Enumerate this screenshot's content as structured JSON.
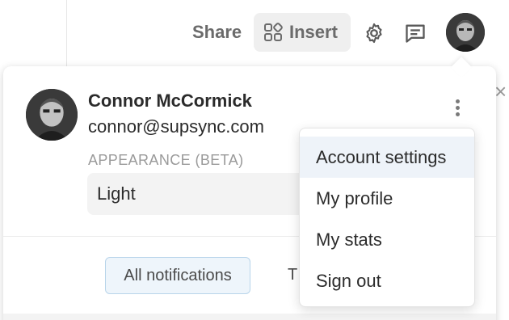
{
  "header": {
    "share_label": "Share",
    "insert_label": "Insert",
    "icons": [
      "apps-grid-icon",
      "gear-icon",
      "chat-icon"
    ]
  },
  "profile": {
    "name": "Connor McCormick",
    "email": "connor@supsync.com"
  },
  "appearance": {
    "label": "APPEARANCE (BETA)",
    "selected": "Light"
  },
  "notifications": {
    "tabs": [
      {
        "label": "All notifications",
        "active": true
      },
      {
        "label": "T",
        "active": false
      }
    ]
  },
  "menu": {
    "items": [
      {
        "label": "Account settings",
        "highlighted": true
      },
      {
        "label": "My profile",
        "highlighted": false
      },
      {
        "label": "My stats",
        "highlighted": false
      },
      {
        "label": "Sign out",
        "highlighted": false
      }
    ]
  },
  "colors": {
    "menu_highlight": "#eef3f9",
    "active_tab_bg": "#eef5fb",
    "active_tab_border": "#b8d4ea"
  }
}
